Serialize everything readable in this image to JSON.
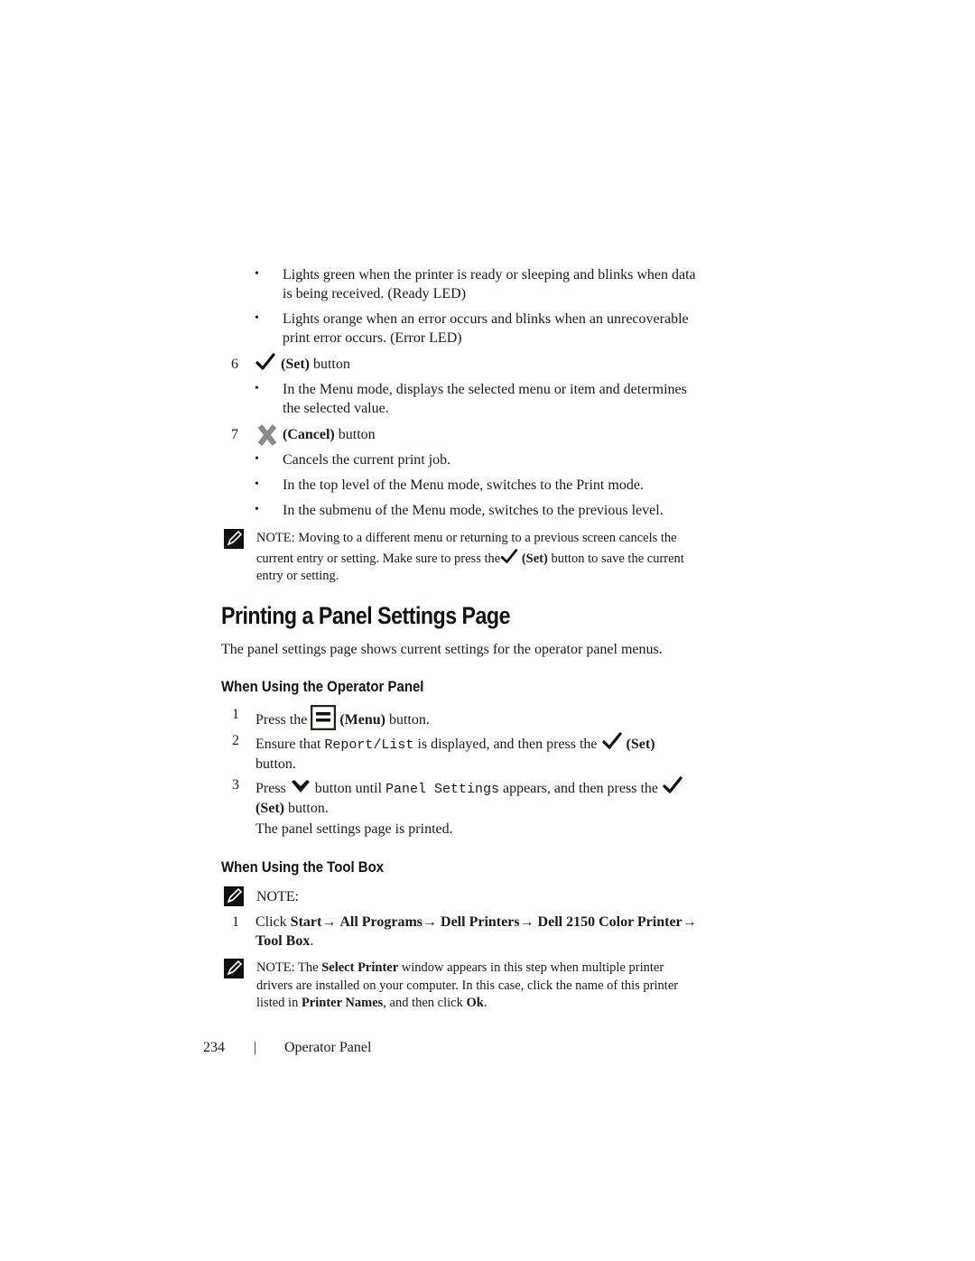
{
  "led_bullets": [
    {
      "line1": "Lights green when the printer is ready or sleeping and blinks when data",
      "line2": "is being received. (Ready LED)"
    },
    {
      "line1": "Lights orange when an error occurs and blinks when an unrecoverable",
      "line2": "print error occurs. (Error LED)"
    }
  ],
  "item6": {
    "number": "6",
    "icon": "checkmark-icon",
    "label_bold": "(Set)",
    "label_rest": " button",
    "bullets": [
      {
        "line1": "In the Menu mode, displays the selected menu or item and determines",
        "line2": "the selected value."
      }
    ]
  },
  "item7": {
    "number": "7",
    "icon": "cancel-x-icon",
    "label_bold": "(Cancel)",
    "label_rest": " button",
    "bullets": [
      "Cancels the current print job.",
      "In the top level of the Menu mode, switches to the Print mode.",
      "In the submenu of the Menu mode, switches to the previous level."
    ]
  },
  "note1": {
    "icon": "note-pencil-icon",
    "line1": "NOTE: Moving to a different menu or returning to a previous screen cancels the",
    "line2_a": "current entry or setting. Make sure to press the",
    "line2_bold": "(Set)",
    "line2_b": " button to save the current",
    "line3": "entry or setting."
  },
  "section": {
    "title": "Printing a Panel Settings Page",
    "intro": "The panel settings page shows current settings for the operator panel menus."
  },
  "operator_panel": {
    "heading": "When Using the Operator Panel",
    "steps": [
      {
        "number": "1",
        "a": "Press the ",
        "icon": "menu-icon",
        "bold": "(Menu)",
        "b": " button."
      },
      {
        "number": "2",
        "a": "Ensure that ",
        "code": "Report/List",
        "b": " is displayed, and then press the ",
        "icon": "checkmark-icon",
        "bold": "(Set)",
        "line2": "button."
      },
      {
        "number": "3",
        "a": "Press ",
        "icon": "chevron-down-icon",
        "b": " button until ",
        "code": "Panel Settings",
        "c": " appears, and then press the ",
        "icon2": "checkmark-icon",
        "bold": "(Set)",
        "d": " button."
      }
    ],
    "result": "The panel settings page is printed."
  },
  "tool_box": {
    "heading": "When Using the Tool Box",
    "note_label": "NOTE:",
    "step": {
      "number": "1",
      "a": "Click ",
      "path": [
        "Start",
        "All Programs",
        "Dell Printers",
        "Dell 2150 Color Printer",
        "Tool Box"
      ],
      "arrow": "→",
      "end": "."
    },
    "note2": {
      "a": "NOTE: The ",
      "bold1": "Select Printer",
      "b": " window appears in this step when multiple printer",
      "line2": "drivers are installed on your computer. In this case, click the name of this printer",
      "line3_a": "listed in ",
      "bold2": "Printer Names",
      "line3_b": ", and then click ",
      "bold3": "Ok",
      "line3_c": "."
    }
  },
  "footer": {
    "page_number": "234",
    "separator": "|",
    "chapter": "Operator Panel"
  }
}
